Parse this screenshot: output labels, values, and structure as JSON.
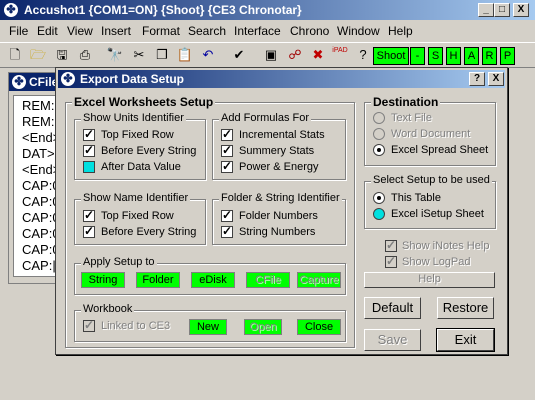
{
  "app": {
    "title": "Accushot1 {COM1=ON} {Shoot}  {CE3 Chronotar}",
    "minimize": "_",
    "restore": "□",
    "close": "X"
  },
  "menu": [
    "File",
    "Edit",
    "View",
    "Insert",
    "Format",
    "Search",
    "Interface",
    "Chrono",
    "Window",
    "Help"
  ],
  "toolbar": {
    "shoot": "Shoot",
    "minus": "-",
    "s": "S",
    "h": "H",
    "a": "A",
    "r": "R",
    "p": "P",
    "ipad": "iPAD"
  },
  "child": {
    "title": "CFile",
    "lines": [
      "REM:",
      "REM:",
      "<End>",
      "DAT>",
      "<End>",
      "CAP:0",
      "CAP:0",
      "CAP:0",
      "CAP:0",
      "CAP:0",
      "CAP:|"
    ]
  },
  "dialog": {
    "title": "Export Data Setup",
    "help": "?",
    "close": "X",
    "excel_setup": "Excel Worksheets Setup",
    "units": {
      "label": "Show Units Identifier",
      "items": [
        "Top Fixed Row",
        "Before Every String",
        "After Data Value"
      ]
    },
    "formulas": {
      "label": "Add Formulas For",
      "items": [
        "Incremental Stats",
        "Summery Stats",
        "Power & Energy"
      ]
    },
    "names": {
      "label": "Show Name Identifier",
      "items": [
        "Top Fixed Row",
        "Before Every String"
      ]
    },
    "folder": {
      "label": "Folder & String Identifier",
      "items": [
        "Folder Numbers",
        "String Numbers"
      ]
    },
    "apply": {
      "label": "Apply Setup to",
      "buttons": [
        "String",
        "Folder",
        "eDisk",
        "CFile",
        "Capture"
      ]
    },
    "workbook": {
      "label": "Workbook",
      "linked": "Linked to CE3",
      "buttons": [
        "New",
        "Open",
        "Close"
      ]
    },
    "destination": {
      "label": "Destination",
      "options": [
        "Text File",
        "Word Document",
        "Excel Spread Sheet"
      ]
    },
    "select_setup": {
      "label": "Select Setup to be used",
      "options": [
        "This Table",
        "Excel iSetup Sheet"
      ]
    },
    "show_inotes": "Show iNotes Help",
    "show_logpad": "Show LogPad",
    "help_btn": "Help",
    "default_btn": "Default",
    "restore_btn": "Restore",
    "save_btn": "Save",
    "exit_btn": "Exit"
  },
  "colors": {
    "title_active": "#0a246a",
    "green": "#00ff00",
    "cyan": "#00e0e0",
    "face": "#d4d0c8"
  }
}
